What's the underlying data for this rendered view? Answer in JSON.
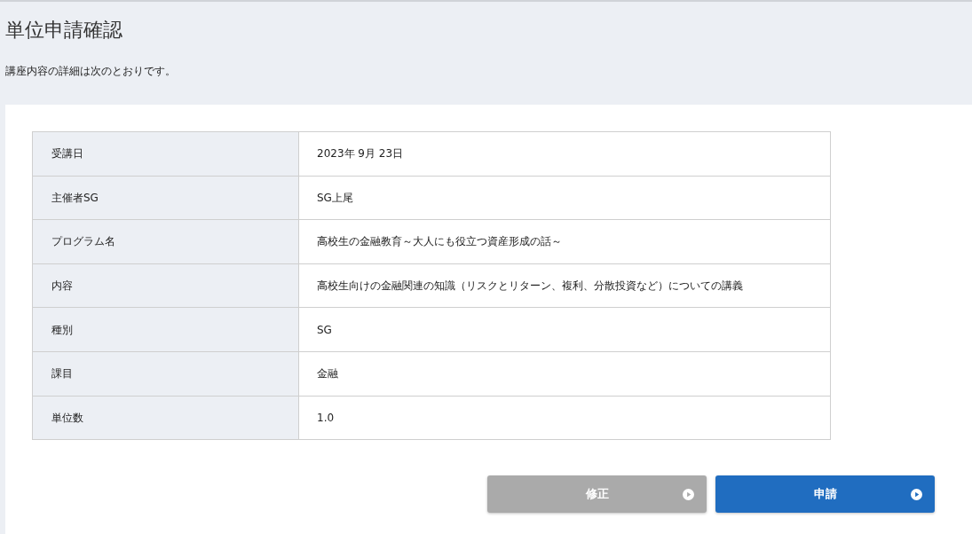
{
  "page": {
    "title": "単位申請確認",
    "description": "講座内容の詳細は次のとおりです。"
  },
  "details": [
    {
      "label": "受講日",
      "value": "2023年 9月 23日"
    },
    {
      "label": "主催者SG",
      "value": "SG上尾"
    },
    {
      "label": "プログラム名",
      "value": "高校生の金融教育～大人にも役立つ資産形成の話～"
    },
    {
      "label": "内容",
      "value": "高校生向けの金融関連の知識（リスクとリターン、複利、分散投資など）についての講義"
    },
    {
      "label": "種別",
      "value": "SG"
    },
    {
      "label": "課目",
      "value": "金融"
    },
    {
      "label": "単位数",
      "value": "1.0"
    }
  ],
  "buttons": [
    {
      "label": "修正",
      "kind": "secondary"
    },
    {
      "label": "申請",
      "kind": "primary"
    }
  ]
}
